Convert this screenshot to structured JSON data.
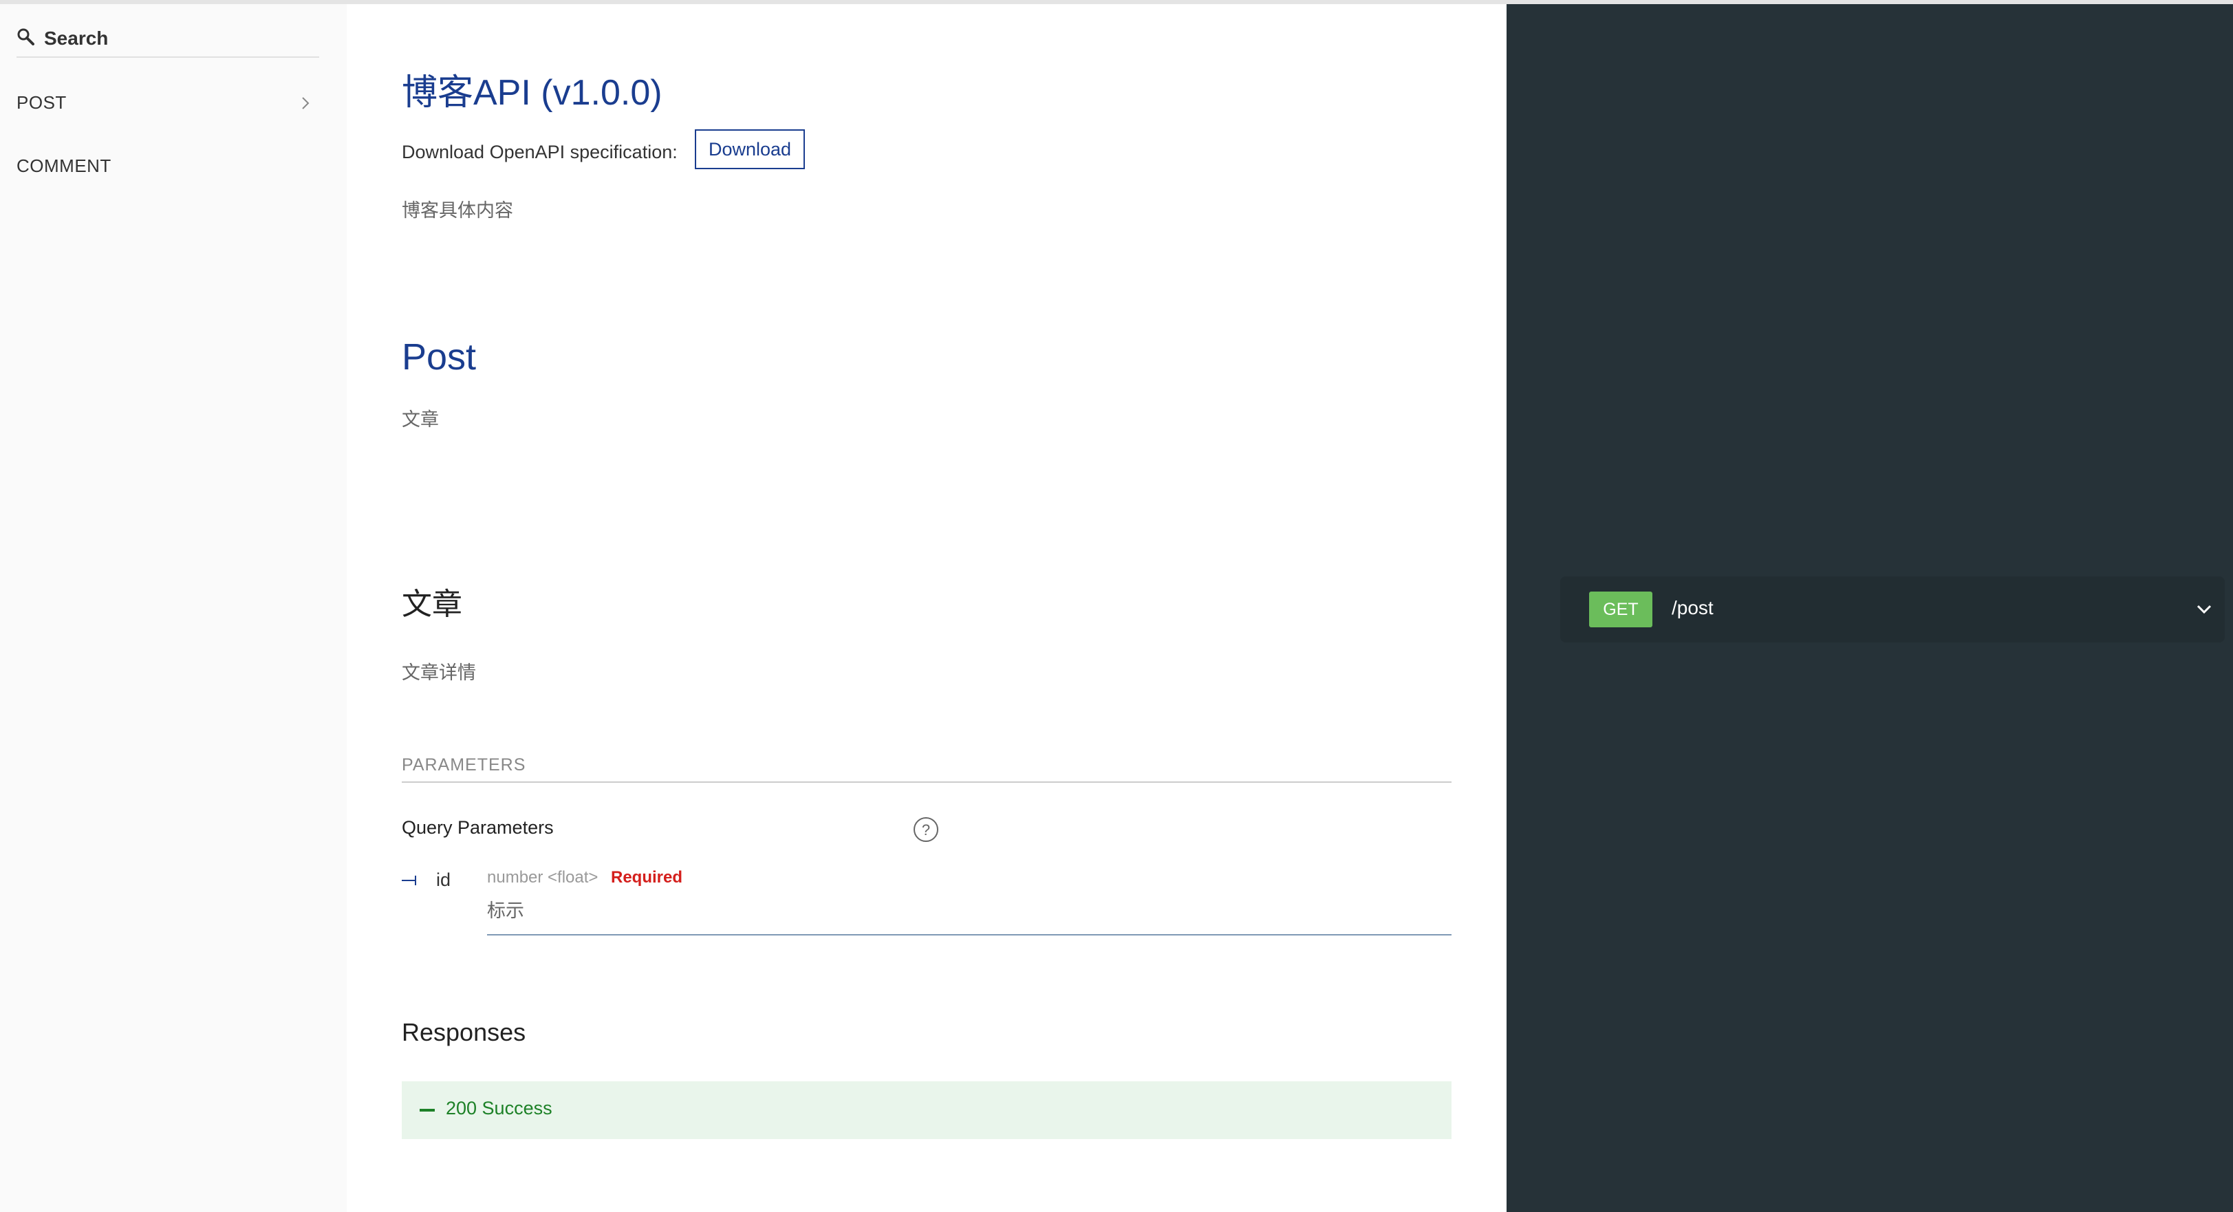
{
  "sidebar": {
    "search_label": "Search",
    "items": [
      {
        "label": "POST",
        "has_chevron": true
      },
      {
        "label": "COMMENT",
        "has_chevron": false
      }
    ]
  },
  "info": {
    "title": "博客API (v1.0.0)",
    "download_label": "Download OpenAPI specification:",
    "download_button": "Download",
    "description": "博客具体内容"
  },
  "tag": {
    "title": "Post",
    "description": "文章"
  },
  "operation": {
    "title": "文章",
    "description": "文章详情",
    "parameters_header": "PARAMETERS",
    "query_params_label": "Query Parameters",
    "params": [
      {
        "name": "id",
        "type": "number <float>",
        "required": "Required",
        "description": "标示"
      }
    ],
    "responses_title": "Responses",
    "responses": [
      {
        "label": "200 Success",
        "color": "#1d8127"
      }
    ]
  },
  "right_panel": {
    "method": "GET",
    "path": "/post",
    "method_color": "#6bbd5b"
  },
  "colors": {
    "accent": "#1a3d8f",
    "panel_bg": "#263238",
    "required": "#d41f1c",
    "success": "#1d8127"
  },
  "icons": {
    "search": "search-icon",
    "chevron_right": "chevron-right-icon",
    "help": "help-icon",
    "param_link": "param-link-icon",
    "collapse": "minus-icon",
    "chevron_down": "chevron-down-icon"
  }
}
